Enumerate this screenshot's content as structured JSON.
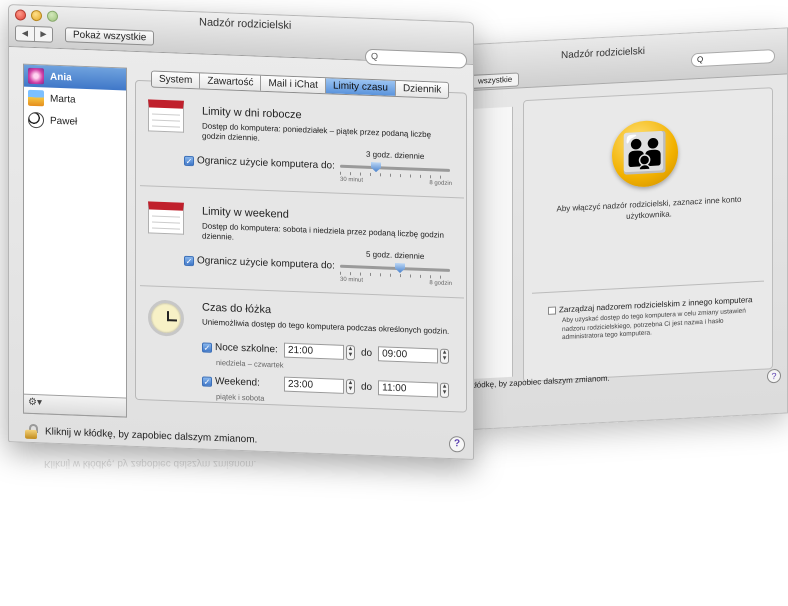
{
  "back_window": {
    "title": "Nadzór rodzicielski",
    "show_all": "wszystkie",
    "search_placeholder": "Q",
    "message": "Aby włączyć nadzór rodzicielski, zaznacz inne konto użytkownika.",
    "remote_checkbox": "Zarządzaj nadzorem rodzicielskim z innego komputera",
    "remote_sub": "Aby uzyskać dostęp do tego komputera w celu zmiany ustawień nadzoru rodzicielskiego, potrzebna Ci jest nazwa i hasło administratora tego komputera.",
    "lock_text": "kłódkę, by zapobiec dalszym zmianom.",
    "help": "?"
  },
  "front_window": {
    "title": "Nadzór rodzicielski",
    "show_all": "Pokaż wszystkie",
    "search_placeholder": "Q",
    "nav_back": "◀",
    "nav_fwd": "▶",
    "users": [
      {
        "name": "Ania",
        "selected": true
      },
      {
        "name": "Marta",
        "selected": false
      },
      {
        "name": "Paweł",
        "selected": false
      }
    ],
    "gear": "⚙▾",
    "tabs": [
      "System",
      "Zawartość",
      "Mail i iChat",
      "Limity czasu",
      "Dziennik"
    ],
    "active_tab": "Limity czasu",
    "weekday": {
      "title": "Limity w dni robocze",
      "desc": "Dostęp do komputera: poniedziałek – piątek przez podaną liczbę godzin dziennie.",
      "checkbox": "Ogranicz użycie komputera do:",
      "value": "3 godz. dziennie",
      "min": "30 minut",
      "max": "8 godzin",
      "slider_fraction": 0.36
    },
    "weekend": {
      "title": "Limity w weekend",
      "desc": "Dostęp do komputera: sobota i niedziela przez podaną liczbę godzin dziennie.",
      "checkbox": "Ogranicz użycie komputera do:",
      "value": "5 godz. dziennie",
      "min": "30 minut",
      "max": "8 godzin",
      "slider_fraction": 0.6
    },
    "bedtime": {
      "title": "Czas do łóżka",
      "desc": "Uniemożliwia dostęp do tego komputera podczas określonych godzin.",
      "school": {
        "label": "Noce szkolne:",
        "sub": "niedziela – czwartek",
        "from": "21:00",
        "to": "09:00"
      },
      "weekend": {
        "label": "Weekend:",
        "sub": "piątek i sobota",
        "from": "23:00",
        "to": "11:00"
      },
      "do": "do"
    },
    "lock_text": "Kliknij w kłódkę, by zapobiec dalszym zmianom.",
    "help": "?"
  },
  "colors": {
    "selection": "#3f77c8",
    "active_tab": "#5a93dc",
    "help_glyph": "#5a3fb0",
    "parental_icon": "#f2b100"
  }
}
